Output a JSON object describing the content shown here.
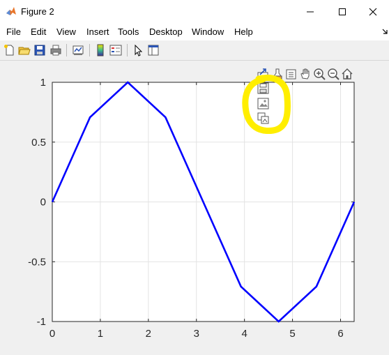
{
  "window": {
    "title": "Figure 2"
  },
  "menu": {
    "items": [
      {
        "label": "File"
      },
      {
        "label": "Edit"
      },
      {
        "label": "View"
      },
      {
        "label": "Insert"
      },
      {
        "label": "Tools"
      },
      {
        "label": "Desktop"
      },
      {
        "label": "Window"
      },
      {
        "label": "Help"
      }
    ]
  },
  "toolbar": {
    "buttons": [
      "new-figure-icon",
      "open-icon",
      "save-icon",
      "print-icon",
      "link-plot-icon",
      "colorbar-icon",
      "legend-icon",
      "edit-plot-icon",
      "property-inspector-icon"
    ]
  },
  "axes_toolbar": {
    "buttons": [
      "export-icon",
      "brush-icon",
      "data-tips-icon",
      "pan-icon",
      "zoom-in-icon",
      "zoom-out-icon",
      "home-icon"
    ],
    "export_menu": [
      "save-as-icon",
      "copy-as-image-icon",
      "copy-as-vector-icon"
    ]
  },
  "annotation": {
    "color": "#ffee00"
  },
  "chart_data": {
    "type": "line",
    "x": [
      0,
      0.785,
      1.571,
      2.356,
      3.142,
      3.927,
      4.712,
      5.498,
      6.283
    ],
    "series": [
      {
        "values": [
          0,
          0.707,
          1,
          0.707,
          0,
          -0.707,
          -1,
          -0.707,
          0
        ],
        "color": "#0000ff"
      }
    ],
    "xlim": [
      0,
      6.283
    ],
    "ylim": [
      -1,
      1
    ],
    "xticks": [
      0,
      1,
      2,
      3,
      4,
      5,
      6
    ],
    "yticks": [
      -1,
      -0.5,
      0,
      0.5,
      1
    ],
    "xtick_labels": [
      "0",
      "1",
      "2",
      "3",
      "4",
      "5",
      "6"
    ],
    "ytick_labels": [
      "-1",
      "-0.5",
      "0",
      "0.5",
      "1"
    ],
    "grid": true
  }
}
